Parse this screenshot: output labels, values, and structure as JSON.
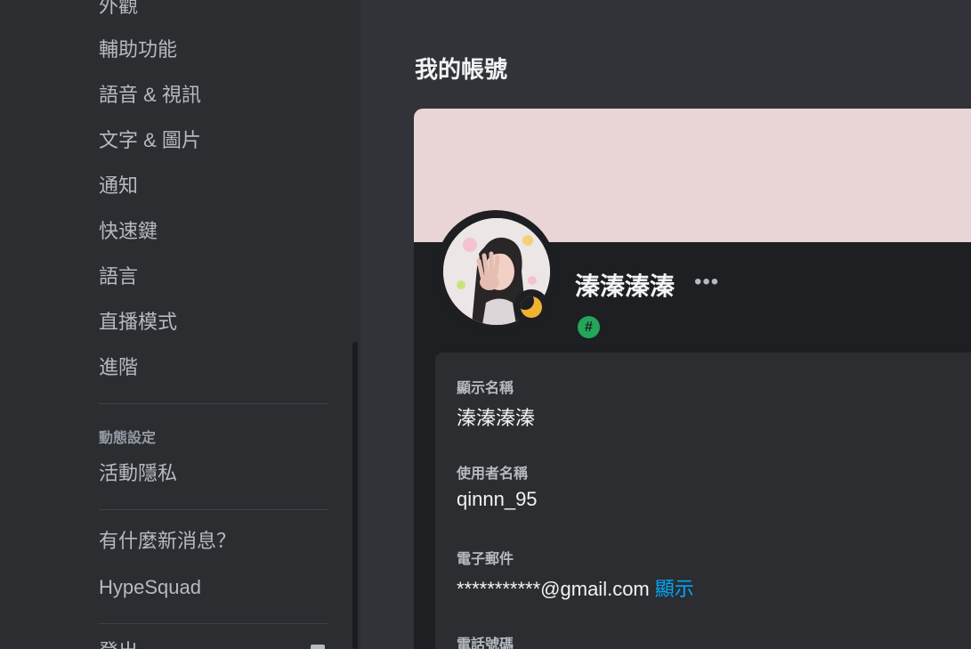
{
  "sidebar": {
    "items": [
      "外觀",
      "輔助功能",
      "語音 & 視訊",
      "文字 & 圖片",
      "通知",
      "快速鍵",
      "語言",
      "直播模式",
      "進階"
    ],
    "activity_header": "動態設定",
    "activity_items": [
      "活動隱私"
    ],
    "extra_items": [
      "有什麼新消息？",
      "HypeSquad"
    ],
    "logout_label": "登出"
  },
  "main": {
    "title": "我的帳號",
    "profile": {
      "display_name": "溱溱溱溱",
      "more_label": "•••",
      "badge_symbol": "#",
      "status": "idle"
    },
    "fields": {
      "display_name_label": "顯示名稱",
      "display_name_value": "溱溱溱溱",
      "username_label": "使用者名稱",
      "username_value": "qinnn_95",
      "email_label": "電子郵件",
      "email_value": "***********@gmail.com",
      "email_reveal": "顯示",
      "phone_label": "電話號碼"
    }
  },
  "colors": {
    "banner": "#e9d5d6",
    "idle_status": "#f0b232",
    "link": "#00a8fc",
    "badge": "#23a55a"
  }
}
